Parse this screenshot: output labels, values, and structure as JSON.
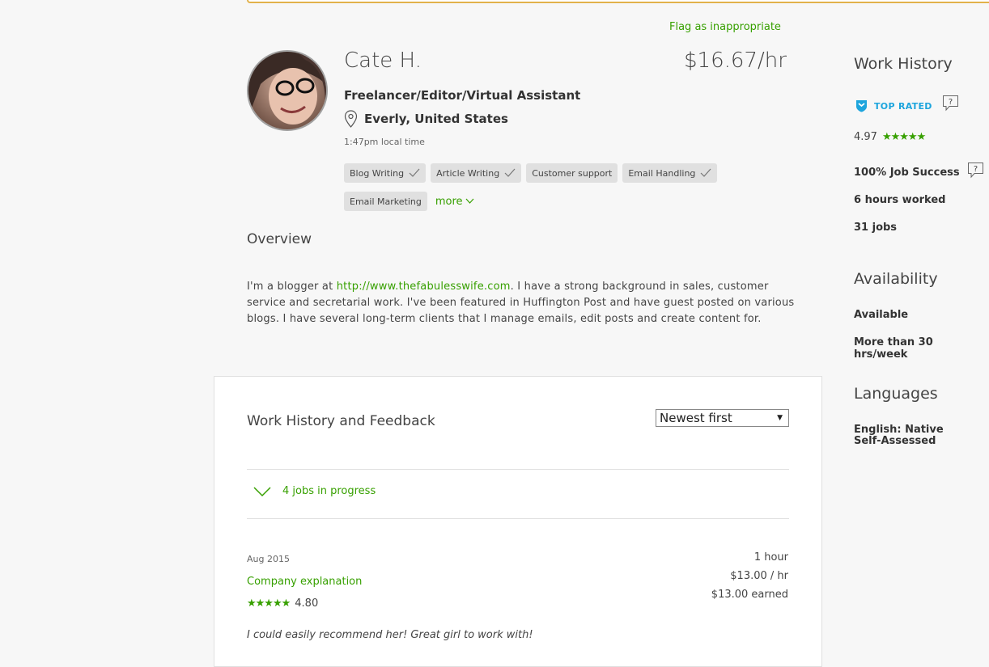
{
  "header": {
    "flag_link": "Flag as inappropriate"
  },
  "profile": {
    "name": "Cate H.",
    "rate": "$16.67/hr",
    "title": "Freelancer/Editor/Virtual Assistant",
    "location": "Everly, United States",
    "local_time": "1:47pm local time",
    "skills": [
      "Blog Writing",
      "Article Writing",
      "Customer support",
      "Email Handling",
      "Email Marketing"
    ],
    "skills_verified": [
      true,
      true,
      false,
      true,
      false
    ],
    "more_label": "more"
  },
  "overview": {
    "heading": "Overview",
    "text_before_link": "I'm a blogger at ",
    "link": "http://www.thefabulesswife.com",
    "text_after_link": ". I have a strong background in sales, customer service and secretarial work. I've been featured in Huffington Post and have guest posted on various blogs. I have several long-term clients that I manage emails, edit posts and create content for."
  },
  "work_history": {
    "heading": "Work History and Feedback",
    "sort_selected": "Newest first",
    "in_progress": "4 jobs in progress",
    "jobs": [
      {
        "date": "Aug 2015",
        "title": "Company explanation",
        "rating": "4.80",
        "stars": 5,
        "hours": "1 hour",
        "rate": "$13.00 / hr",
        "earned": "$13.00 earned",
        "feedback": "I could easily recommend her! Great girl to work with!"
      }
    ]
  },
  "sidebar": {
    "work_history_heading": "Work History",
    "top_rated": "TOP RATED",
    "rating": "4.97",
    "job_success": "100% Job Success",
    "hours_worked": "6 hours worked",
    "jobs": "31 jobs",
    "availability_heading": "Availability",
    "availability": "Available",
    "availability_hours": "More than 30 hrs/week",
    "languages_heading": "Languages",
    "language_line1": "English: Native",
    "language_line2": "Self-Assessed"
  },
  "colors": {
    "accent": "#37a000",
    "top_rated": "#1da5dd",
    "warning_border": "#e2b24a"
  }
}
